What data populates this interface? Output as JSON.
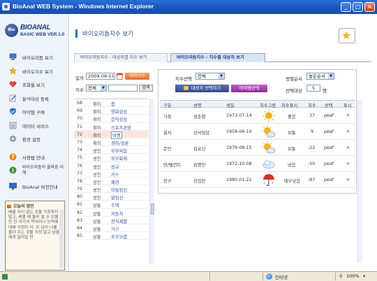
{
  "window": {
    "title": "BioAnal WEB System - Windows Internet Explorer"
  },
  "logo": {
    "mark": "Bio",
    "name": "BIOANAL",
    "subtitle": "BASIC WEB VER.1.0"
  },
  "menu": [
    {
      "label": "바이오리듬 보기",
      "icon": "computer-icon"
    },
    {
      "label": "바이오지수 보기",
      "icon": "star-icon"
    },
    {
      "label": "조화율 보기",
      "icon": "heart-icon"
    },
    {
      "label": "분석대상 등록",
      "icon": "pen-icon"
    },
    {
      "label": "아이템 구매",
      "icon": "shield-icon"
    },
    {
      "label": "데이터 서비스",
      "icon": "data-icon"
    },
    {
      "label": "환경 설정",
      "icon": "gear-icon"
    },
    {
      "label": "사용법 안내",
      "icon": "help-icon"
    },
    {
      "label": "바이오리듬의 올바른 이해",
      "icon": "info-icon"
    },
    {
      "label": "BioAnal 버전안내",
      "icon": "monitor-icon"
    }
  ],
  "news": {
    "heading": "오늘의 명언",
    "text": "배울 자리 없는 것을 걱정하지 말고, 배울 때 들러 설 수 있을 만 한 자기의 학식이나 능력에 대해 걱정하 라. 또 남이 나를 몰라 주는 것을 걱정 말고 남들에게 알려질 만"
  },
  "page": {
    "title": "바이오리듬지수 보기"
  },
  "tabs": [
    {
      "label": "바이오리듬지수 - 대상자별 지수 보기",
      "active": false
    },
    {
      "label": "바이오리듬지수 - 지수별 대상자 보기",
      "active": true
    }
  ],
  "left_form": {
    "date_label": "일자",
    "date_value": "2009-09-15",
    "today_button": "이미지수",
    "index_label": "지수",
    "index_select": "전체",
    "search_value": "",
    "search_button": "검색"
  },
  "left_rows": [
    {
      "no": "68",
      "kind": "취미",
      "name": "춤"
    },
    {
      "no": "69",
      "kind": "취미",
      "name": "영화감상"
    },
    {
      "no": "70",
      "kind": "취미",
      "name": "음악감상"
    },
    {
      "no": "71",
      "kind": "취미",
      "name": "스포츠관람"
    },
    {
      "no": "72",
      "kind": "취미",
      "name": "여행",
      "selected": true
    },
    {
      "no": "73",
      "kind": "취미",
      "name": "경마/경륜"
    },
    {
      "no": "74",
      "kind": "성인",
      "name": "부부싸움"
    },
    {
      "no": "75",
      "kind": "성인",
      "name": "부부화해"
    },
    {
      "no": "76",
      "kind": "성인",
      "name": "성교"
    },
    {
      "no": "77",
      "kind": "성인",
      "name": "키스"
    },
    {
      "no": "78",
      "kind": "성인",
      "name": "폐경"
    },
    {
      "no": "79",
      "kind": "성인",
      "name": "아들임신"
    },
    {
      "no": "80",
      "kind": "성인",
      "name": "딸임신"
    },
    {
      "no": "81",
      "kind": "상통",
      "name": "주택"
    },
    {
      "no": "82",
      "kind": "상통",
      "name": "자동차"
    },
    {
      "no": "83",
      "kind": "상통",
      "name": "전자제품"
    },
    {
      "no": "84",
      "kind": "상통",
      "name": "가구"
    },
    {
      "no": "85",
      "kind": "상통",
      "name": "조부모품"
    }
  ],
  "right_form": {
    "index_select_label": "지수선택",
    "index_select_value": "전체",
    "sort_label": "정렬순서",
    "sort_value": "높은순서",
    "target_button": "대상자 선택하기",
    "item_button": "아이템선택",
    "count_label": "선택대상",
    "count_value": "5",
    "count_unit": "명"
  },
  "table": {
    "headers": [
      "구분",
      "성명",
      "생일",
      "지수그림",
      "지수표시",
      "지수",
      "선택",
      "표시"
    ],
    "rows": [
      {
        "group": "가족",
        "name": "성춘향",
        "birth": "1973-07-14",
        "weather": "sun-icon",
        "label": "좋음",
        "score": "37",
        "pick": "peaf",
        "mark": "+"
      },
      {
        "group": "회사",
        "name": "산사임당",
        "birth": "1958-06-10",
        "weather": "sun-cloud-icon",
        "label": "보통",
        "score": "9",
        "pick": "peaf",
        "mark": "+"
      },
      {
        "group": "문인",
        "name": "김유신",
        "birth": "1979-08-15",
        "weather": "sun-cloud-icon",
        "label": "보통",
        "score": "-22",
        "pick": "peaf",
        "mark": "+"
      },
      {
        "group": "연/탤런트",
        "name": "김명민",
        "birth": "1972-10-08",
        "weather": "cloud-icon",
        "label": "낮음",
        "score": "-50",
        "pick": "peaf",
        "mark": "+"
      },
      {
        "group": "친구",
        "name": "강감찬",
        "birth": "1980-01-22",
        "weather": "umbrella-icon",
        "label": "매우낮음",
        "score": "-87",
        "pick": "peaf",
        "mark": "+"
      }
    ]
  },
  "status": {
    "zone": "인터넷",
    "zoom": "100%"
  },
  "colors": {
    "accent": "#2e6fb5",
    "orange": "#e06f2a",
    "navy": "#35478a",
    "purple": "#8a2e95"
  }
}
